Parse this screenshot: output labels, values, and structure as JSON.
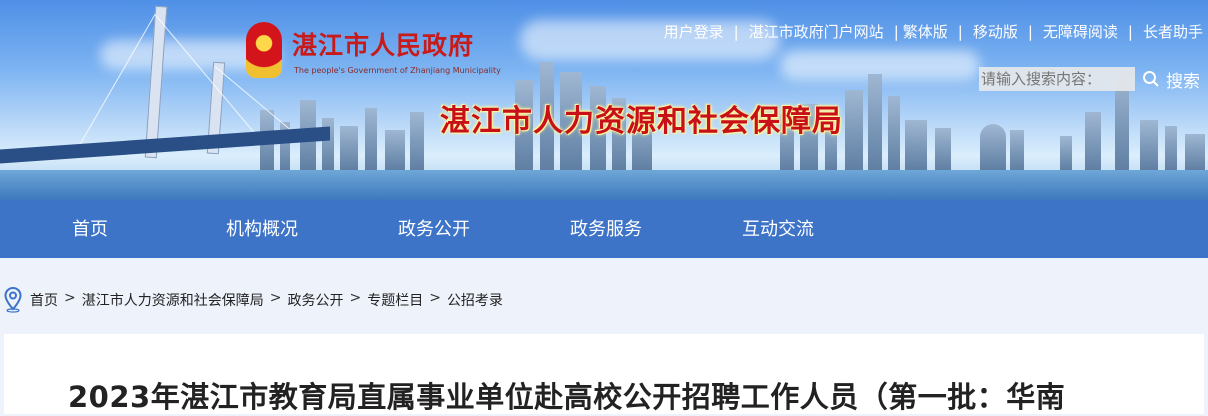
{
  "header": {
    "gov_name": "湛江市人民政府",
    "gov_name_en": "The people's Government of Zhanjiang Municipality",
    "bureau_name": "湛江市人力资源和社会保障局",
    "top_links": [
      "用户登录",
      "湛江市政府门户网站",
      "繁体版",
      "移动版",
      "无障碍阅读",
      "长者助手"
    ],
    "search": {
      "placeholder": "请输入搜索内容：",
      "button_label": "搜索"
    }
  },
  "nav": {
    "items": [
      "首页",
      "机构概况",
      "政务公开",
      "政务服务",
      "互动交流"
    ]
  },
  "breadcrumb": {
    "items": [
      "首页",
      "湛江市人力资源和社会保障局",
      "政务公开",
      "专题栏目",
      "公招考录"
    ]
  },
  "article": {
    "title": "2023年湛江市教育局直属事业单位赴高校公开招聘工作人员（第一批：华南"
  },
  "colors": {
    "nav_bg": "#3d74c8",
    "bureau_text": "#c8101a",
    "page_bg": "#eef3fb"
  }
}
